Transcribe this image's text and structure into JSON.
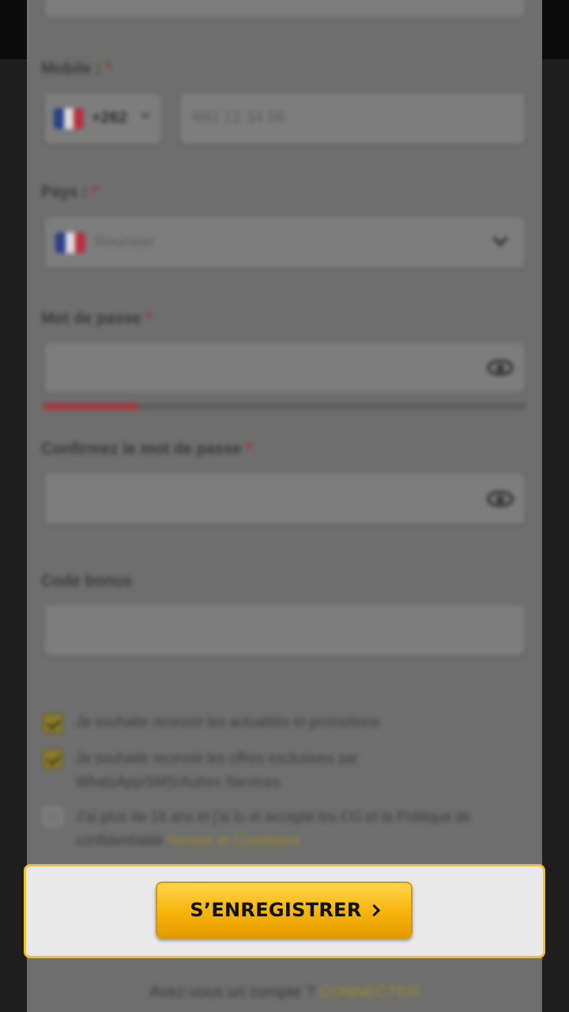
{
  "form": {
    "mobile": {
      "label": "Mobile :",
      "required": "*",
      "country_code": "+262",
      "placeholder": "692 12 34 56"
    },
    "country": {
      "label": "Pays :",
      "required": "*",
      "value": "Reunion"
    },
    "password": {
      "label": "Mot de passe",
      "required": "*",
      "strength": 0.2
    },
    "confirm_password": {
      "label": "Confirmez le mot de passe",
      "required": "*"
    },
    "bonus_code": {
      "label": "Code bonus"
    },
    "checkboxes": [
      {
        "text": "Je souhaite recevoir les actualités et promotions",
        "checked": true
      },
      {
        "text_line1": "Je souhaite recevoir les offres exclusives par",
        "text_line2": "WhatsApp/SMS/Autres Services",
        "checked": true
      },
      {
        "text_line1": "J'ai plus de 18 ans et j'ai lu et accepté les CG et la Politique de",
        "text_line2_prefix": "confidentialité",
        "link": "Termes et Conditions",
        "checked": false
      }
    ]
  },
  "register_button": {
    "label": "S’ENREGISTRER"
  },
  "login": {
    "prompt": "Avez-vous un compte ?",
    "link": "CONNECTER"
  },
  "colors": {
    "accent": "#f6b40a",
    "highlight_border": "#f2c029",
    "strength_weak": "#a83438"
  }
}
